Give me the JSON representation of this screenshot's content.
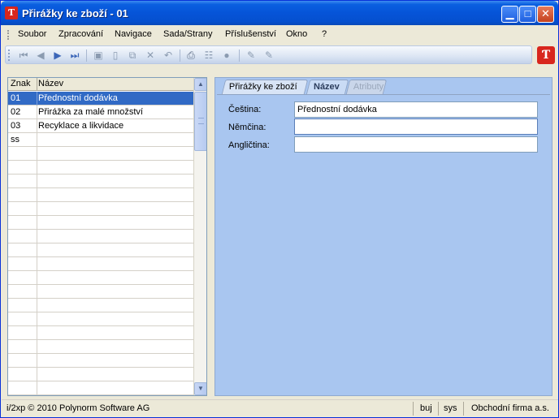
{
  "window": {
    "title": "Přirážky ke zboží - 01",
    "icon_text": "Ƭ"
  },
  "menu": [
    "Soubor",
    "Zpracování",
    "Navigace",
    "Sada/Strany",
    "Příslušenství",
    "Okno",
    "?"
  ],
  "toolbar": {
    "icons": [
      "first-record-icon",
      "previous-record-icon",
      "next-record-icon",
      "last-record-icon",
      "save-icon",
      "new-record-icon",
      "copy-record-icon",
      "delete-icon",
      "undo-icon",
      "print-icon",
      "tree-icon",
      "refresh-icon",
      "edit-icon",
      "edit-field-icon"
    ],
    "brand_logo": "Ƭ"
  },
  "grid": {
    "columns": [
      "Znak",
      "Název"
    ],
    "rows": [
      {
        "code": "01",
        "name": "Přednostní dodávka",
        "selected": true
      },
      {
        "code": "02",
        "name": "Přirážka za malé množství"
      },
      {
        "code": "03",
        "name": "Recyklace a likvidace"
      },
      {
        "code": "ss",
        "name": ""
      }
    ]
  },
  "tabs": [
    {
      "label": "Přirážky ke zboží",
      "state": "normal"
    },
    {
      "label": "Název",
      "state": "active"
    },
    {
      "label": "Atributy",
      "state": "disabled"
    }
  ],
  "form": {
    "fields": [
      {
        "label": "Čeština:",
        "value": "Přednostní dodávka"
      },
      {
        "label": "Němčina:",
        "value": ""
      },
      {
        "label": "Angličtina:",
        "value": ""
      }
    ]
  },
  "status": {
    "copyright": "i/2xp © 2010 Polynorm Software AG",
    "user": "buj",
    "db": "sys",
    "company": "Obchodní firma a.s."
  },
  "colors": {
    "selection": "#316ac5",
    "panel": "#a9c6f0",
    "titlebar": "#0654d8"
  }
}
